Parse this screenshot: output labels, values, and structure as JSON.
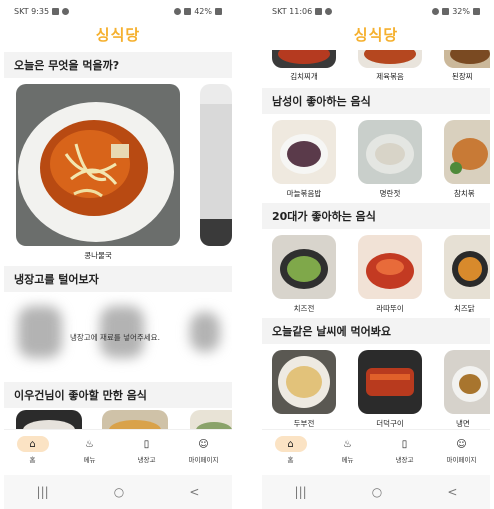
{
  "left": {
    "status": {
      "time": "SKT 9:35",
      "battery": "42%"
    },
    "logo": "싱식당",
    "sections": {
      "today": "오늘은 무엇을 먹을까?",
      "fridge": "냉장고를 털어보자",
      "neighbor": "이우건님이 좋아할 만한 음식"
    },
    "featured": {
      "caption": "콩나물국"
    },
    "fridge_empty": "냉장고에 재료를 넣어주세요."
  },
  "right": {
    "status": {
      "time": "SKT 11:06",
      "battery": "32%"
    },
    "logo": "싱식당",
    "top_row": [
      "김치찌개",
      "제육볶음",
      "된장찌"
    ],
    "sections": [
      {
        "title": "남성이 좋아하는 음식",
        "items": [
          "마늘볶음밥",
          "명란젓",
          "참치볶"
        ]
      },
      {
        "title": "20대가 좋아하는 음식",
        "items": [
          "치즈전",
          "라따뚜이",
          "치즈닭"
        ]
      },
      {
        "title": "오늘같은 날씨에 먹어봐요",
        "items": [
          "두부전",
          "더덕구이",
          "냉면"
        ]
      }
    ]
  },
  "nav": {
    "home": "홈",
    "menu": "메뉴",
    "fridge": "냉장고",
    "mypage": "마이페이지"
  },
  "sys_nav": {
    "recent": "|||",
    "home": "○",
    "back": "<"
  }
}
